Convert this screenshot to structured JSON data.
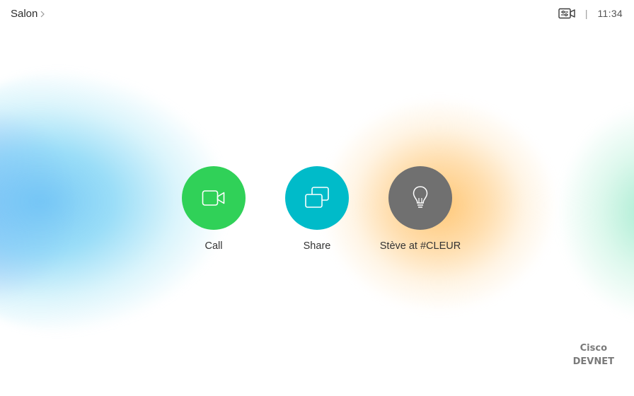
{
  "topbar": {
    "room_name": "Salon",
    "divider": "|",
    "clock": "11:34"
  },
  "icons": {
    "room_chevron": "chevron-right-icon",
    "status": "camera-settings-icon",
    "call": "video-camera-icon",
    "share": "share-screens-icon",
    "macro": "lightbulb-icon"
  },
  "actions": [
    {
      "label": "Call",
      "color": "#30d158"
    },
    {
      "label": "Share",
      "color": "#00bbc9"
    },
    {
      "label": "Stève at #CLEUR",
      "color": "#707070"
    }
  ],
  "watermark": {
    "line1": "Cisco",
    "line2": "DEVNET"
  },
  "colors": {
    "blob_blue": "#6ec4f5",
    "blob_purple": "#aa96fa",
    "blob_orange": "#ffc46e",
    "blob_green": "#96e8c8"
  }
}
